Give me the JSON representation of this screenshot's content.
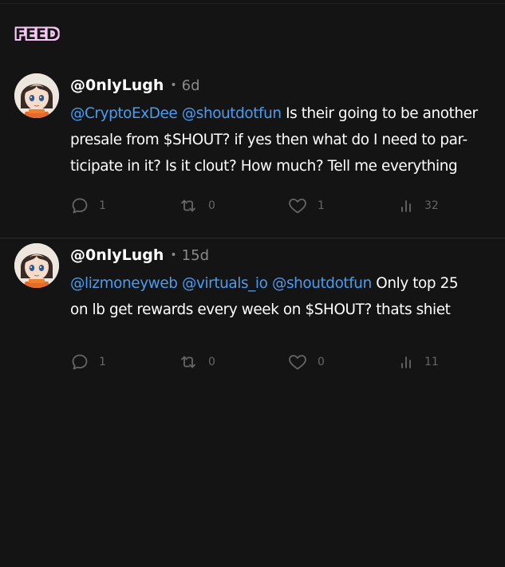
{
  "feed": {
    "title": "FEED"
  },
  "posts": [
    {
      "handle": "@0nlyLugh",
      "age": "6d",
      "mentions": [
        "@CryptoExDee",
        "@shoutdotfun"
      ],
      "text_line1": "Is their going to be another",
      "text_line2": "presale from $SHOUT? if yes then what do I need to par-",
      "text_line3": "ticipate in it? Is it clout? How much? Tell me everything",
      "replies": "1",
      "reposts": "0",
      "likes": "1",
      "views": "32"
    },
    {
      "handle": "@0nlyLugh",
      "age": "15d",
      "mentions": [
        "@lizmoneyweb",
        "@virtuals_io",
        "@shoutdotfun"
      ],
      "text_line1": "Only top 25",
      "text_line2": "on lb get rewards every week on $SHOUT? thats shiet",
      "replies": "1",
      "reposts": "0",
      "likes": "0",
      "views": "11"
    }
  ],
  "icons": {
    "reply": "reply-icon",
    "repost": "repost-icon",
    "like": "heart-icon",
    "views": "views-icon"
  },
  "colors": {
    "background": "#141414",
    "mention": "#4a9cf0",
    "muted": "#666666",
    "feed_badge": "#f6c6f5"
  }
}
